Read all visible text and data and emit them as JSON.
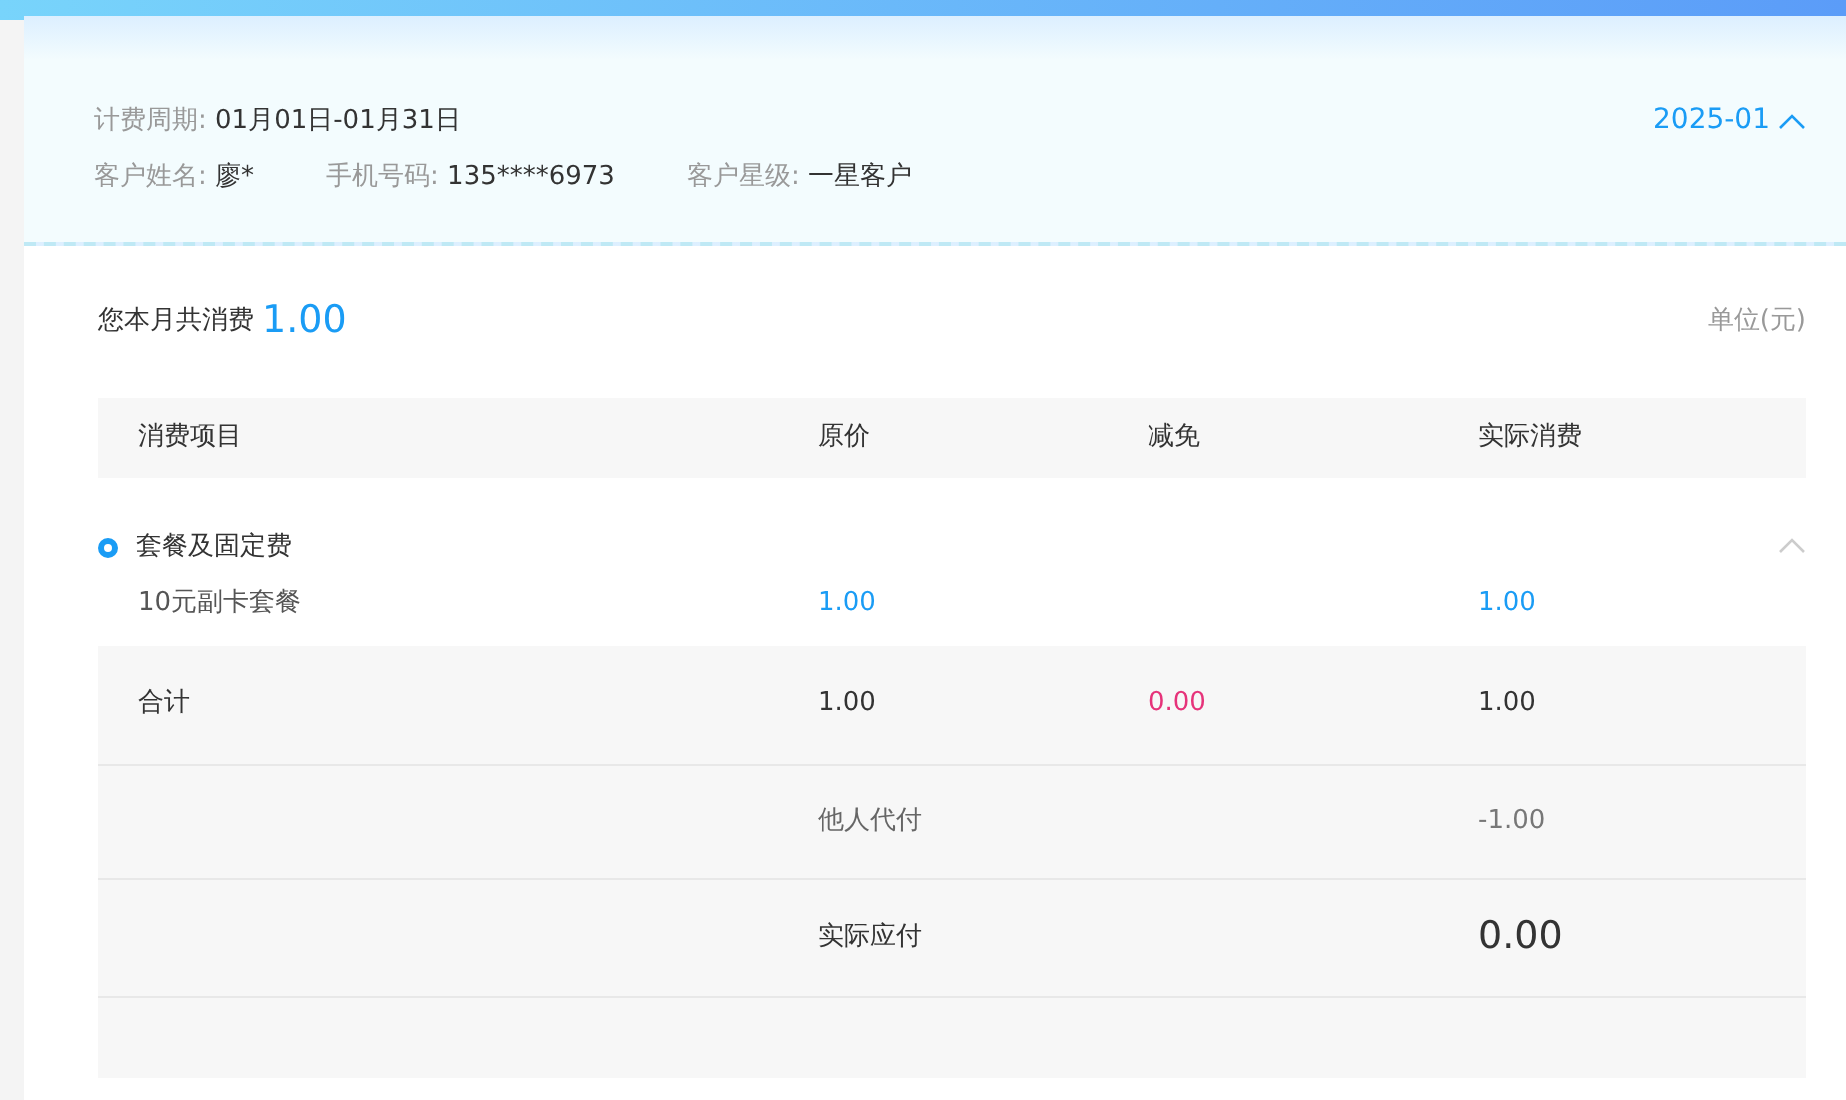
{
  "billing_period": {
    "label": "计费周期:",
    "value": "01月01日-01月31日"
  },
  "month_selector": {
    "value": "2025-01",
    "expanded": true
  },
  "customer": [
    {
      "label": "客户姓名:",
      "value": "廖*"
    },
    {
      "label": "手机号码:",
      "value": "135****6973"
    },
    {
      "label": "客户星级:",
      "value": "一星客户"
    }
  ],
  "summary": {
    "label": "您本月共消费",
    "amount": "1.00",
    "unit": "单位(元)"
  },
  "table": {
    "columns": [
      "消费项目",
      "原价",
      "减免",
      "实际消费"
    ],
    "groups": [
      {
        "name": "套餐及固定费",
        "expanded": true,
        "items": [
          {
            "name": "10元副卡套餐",
            "original": "1.00",
            "actual": "1.00"
          }
        ]
      }
    ],
    "total": {
      "label": "合计",
      "original": "1.00",
      "discount": "0.00",
      "actual": "1.00"
    },
    "extra_rows": [
      {
        "kind": "adjust",
        "label": "他人代付",
        "value": "-1.00"
      },
      {
        "kind": "payable",
        "label": "实际应付",
        "value": "0.00"
      }
    ]
  }
}
